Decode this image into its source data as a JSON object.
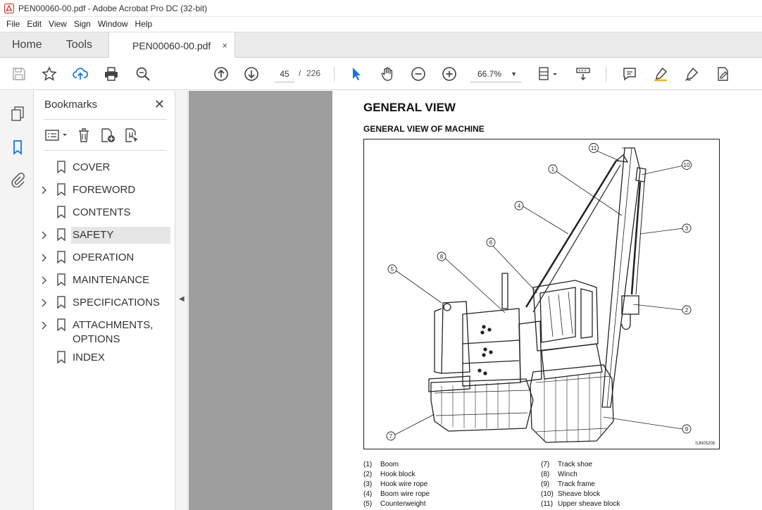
{
  "window": {
    "title": "PEN00060-00.pdf - Adobe Acrobat Pro DC (32-bit)"
  },
  "menu": [
    "File",
    "Edit",
    "View",
    "Sign",
    "Window",
    "Help"
  ],
  "tabs": {
    "home": "Home",
    "tools": "Tools",
    "document": "PEN00060-00.pdf",
    "close": "×"
  },
  "toolbar": {
    "page_current": "45",
    "page_sep": "/",
    "page_total": "226",
    "zoom": "66.7%"
  },
  "bookmarks": {
    "title": "Bookmarks",
    "close": "✕",
    "items": [
      {
        "label": "COVER",
        "expandable": false
      },
      {
        "label": "FOREWORD",
        "expandable": true
      },
      {
        "label": "CONTENTS",
        "expandable": false
      },
      {
        "label": "SAFETY",
        "expandable": true,
        "selected": true
      },
      {
        "label": "OPERATION",
        "expandable": true
      },
      {
        "label": "MAINTENANCE",
        "expandable": true
      },
      {
        "label": "SPECIFICATIONS",
        "expandable": true
      },
      {
        "label": "ATTACHMENTS, OPTIONS",
        "expandable": true
      },
      {
        "label": "INDEX",
        "expandable": false
      }
    ]
  },
  "page": {
    "heading": "GENERAL VIEW",
    "subheading": "GENERAL VIEW OF MACHINE",
    "figure_code": "SJN05208",
    "legend": [
      {
        "num": "(1)",
        "text": "Boom"
      },
      {
        "num": "(2)",
        "text": "Hook block"
      },
      {
        "num": "(3)",
        "text": "Hook wire rope"
      },
      {
        "num": "(4)",
        "text": "Boom wire rope"
      },
      {
        "num": "(5)",
        "text": "Counterweight"
      },
      {
        "num": "(7)",
        "text": "Track shoe"
      },
      {
        "num": "(8)",
        "text": "Winch"
      },
      {
        "num": "(9)",
        "text": "Track frame"
      },
      {
        "num": "(10)",
        "text": "Sheave block"
      },
      {
        "num": "(11)",
        "text": "Upper sheave block"
      }
    ],
    "callouts": [
      "1",
      "2",
      "3",
      "4",
      "5",
      "6",
      "7",
      "8",
      "9",
      "10",
      "11"
    ]
  },
  "colors": {
    "accent_blue": "#1473e6",
    "doc_bg": "#9e9e9e",
    "app_red": "#d4291c"
  }
}
